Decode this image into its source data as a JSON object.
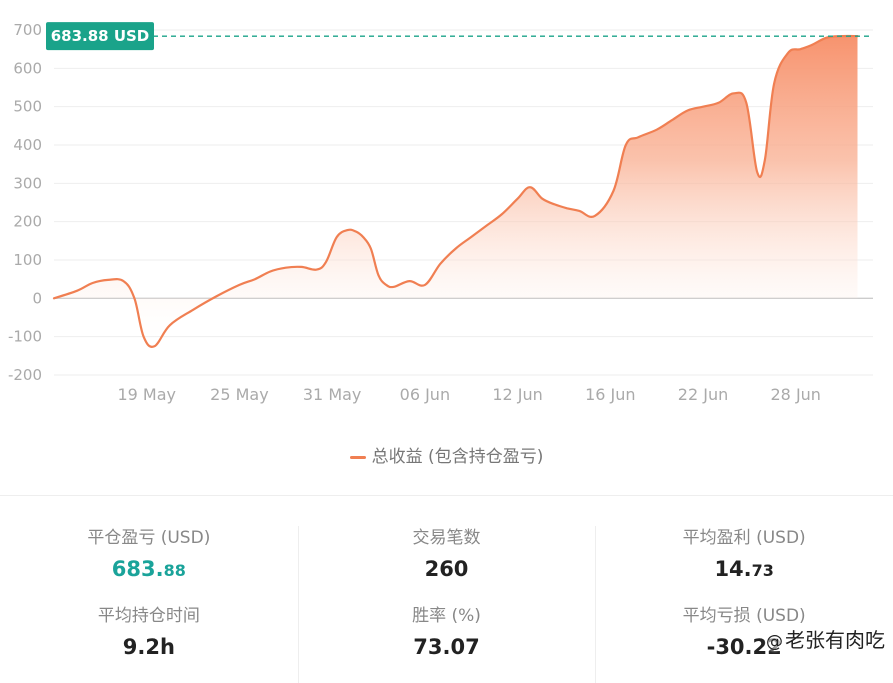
{
  "chart_data": {
    "type": "area",
    "ylim": [
      -200,
      700
    ],
    "yticks": [
      "700",
      "600",
      "500",
      "400",
      "300",
      "200",
      "100",
      "0",
      "-100",
      "-200"
    ],
    "ytick_values": [
      700,
      600,
      500,
      400,
      300,
      200,
      100,
      0,
      -100,
      -200
    ],
    "xticks": [
      "19 May",
      "25 May",
      "31 May",
      "06 Jun",
      "12 Jun",
      "16 Jun",
      "22 Jun",
      "28 Jun"
    ],
    "xtick_positions": [
      4,
      10,
      16,
      22,
      28,
      34,
      40,
      46
    ],
    "xlim": [
      -2,
      51
    ],
    "current_label": "683.88 USD",
    "current_value": 683.88,
    "legend_label": "总收益 (包含持仓盈亏)",
    "colors": {
      "line": "#f07f52",
      "fill_top": "#f7936e",
      "marker": "#1aa38a",
      "grid": "#eeeeee",
      "zero_line": "#cccccc"
    },
    "series": [
      {
        "x": [
          -2,
          -0.5,
          0.5,
          1.5,
          2.5,
          3.2,
          3.8,
          4.5,
          5.5,
          7,
          8.5,
          10,
          11,
          12,
          13,
          14,
          15,
          15.6,
          16.3,
          17,
          17.5,
          18,
          18.5,
          19,
          19.5,
          20,
          21,
          22,
          23,
          24,
          25,
          26,
          27,
          28,
          28.8,
          29.6,
          30.4,
          31.2,
          32,
          33,
          34.2,
          35,
          35.8,
          37,
          38,
          39,
          40,
          41,
          42,
          42.8,
          43.5,
          44,
          44.6,
          45.5,
          46.3,
          47,
          48,
          49,
          50
        ],
        "y": [
          0,
          20,
          40,
          48,
          45,
          0,
          -100,
          -125,
          -70,
          -30,
          5,
          35,
          50,
          70,
          80,
          82,
          75,
          95,
          160,
          178,
          175,
          160,
          130,
          60,
          35,
          30,
          45,
          35,
          90,
          130,
          160,
          190,
          220,
          260,
          290,
          260,
          245,
          235,
          228,
          215,
          280,
          400,
          420,
          440,
          465,
          490,
          500,
          510,
          535,
          510,
          330,
          360,
          560,
          640,
          650,
          660,
          680,
          684,
          684
        ]
      }
    ]
  },
  "legend": {
    "label": "总收益 (包含持仓盈亏)"
  },
  "stats": {
    "closed_pnl": {
      "label": "平仓盈亏 (USD)",
      "int": "683.",
      "dec": "88"
    },
    "avg_hold_time": {
      "label": "平均持仓时间",
      "value": "9.2h"
    },
    "trade_count": {
      "label": "交易笔数",
      "value": "260"
    },
    "win_rate": {
      "label": "胜率 (%)",
      "value": "73.07"
    },
    "avg_profit": {
      "label": "平均盈利 (USD)",
      "int": "14.",
      "dec": "73"
    },
    "avg_loss": {
      "label": "平均亏损 (USD)",
      "value": "-30.22"
    }
  },
  "watermark": {
    "icon": "at-icon",
    "icon_glyph": "@",
    "text": "老张有肉吃"
  }
}
